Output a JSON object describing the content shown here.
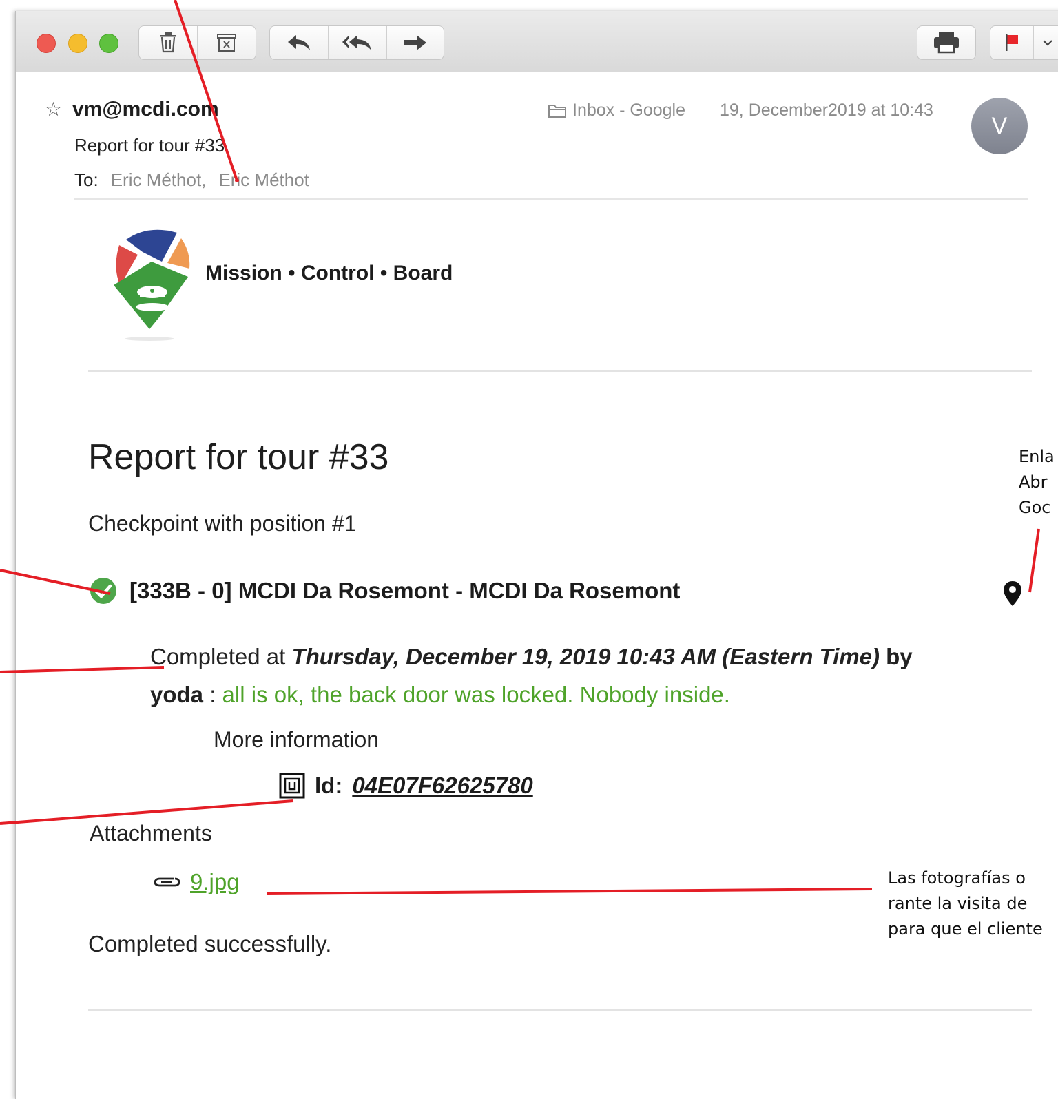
{
  "toolbar": {
    "buttons": [
      {
        "name": "trash-icon"
      },
      {
        "name": "archive-icon"
      },
      {
        "name": "reply-icon"
      },
      {
        "name": "reply-all-icon"
      },
      {
        "name": "forward-icon"
      },
      {
        "name": "print-icon"
      },
      {
        "name": "flag-icon"
      }
    ],
    "flag_color": "#e8262b"
  },
  "header": {
    "star": "☆",
    "from": "vm@mcdi.com",
    "mailbox": "Inbox - Google",
    "date": "19, December2019 at 10:43",
    "avatar_initial": "V",
    "subject": "Report for tour #33",
    "to_label": "To:",
    "recipients": [
      "Eric Méthot,",
      "Eric Méthot"
    ]
  },
  "logo": {
    "text": "Mission • Control • Board",
    "colors": {
      "blue": "#2d4593",
      "red": "#dd4a47",
      "orange": "#ef9a52",
      "green": "#3e9b3e"
    }
  },
  "report": {
    "title": "Report for tour #33",
    "checkpoint": "Checkpoint with position #1",
    "item_title": "[333B - 0] MCDI Da Rosemont - MCDI Da Rosemont",
    "completed_prefix": "Completed at ",
    "completed_datetime": "Thursday, December 19, 2019 10:43 AM (Eastern Time)",
    "by_word": " by",
    "user": "yoda",
    "separator": " : ",
    "comment": "all is ok, the back door was locked. Nobody inside.",
    "more_info": "More information",
    "id_label": "Id:",
    "id_value": "04E07F62625780",
    "attachments_label": "Attachments",
    "attachment_file": "9.jpg",
    "footer": "Completed successfully."
  },
  "annotations": {
    "right_lines": [
      "Enla",
      "Abr",
      "Goc"
    ],
    "bottom_lines": [
      "Las  fotografías  o",
      "rante  la  visita  de",
      "para que el cliente"
    ],
    "line_color": "#e41e26"
  }
}
